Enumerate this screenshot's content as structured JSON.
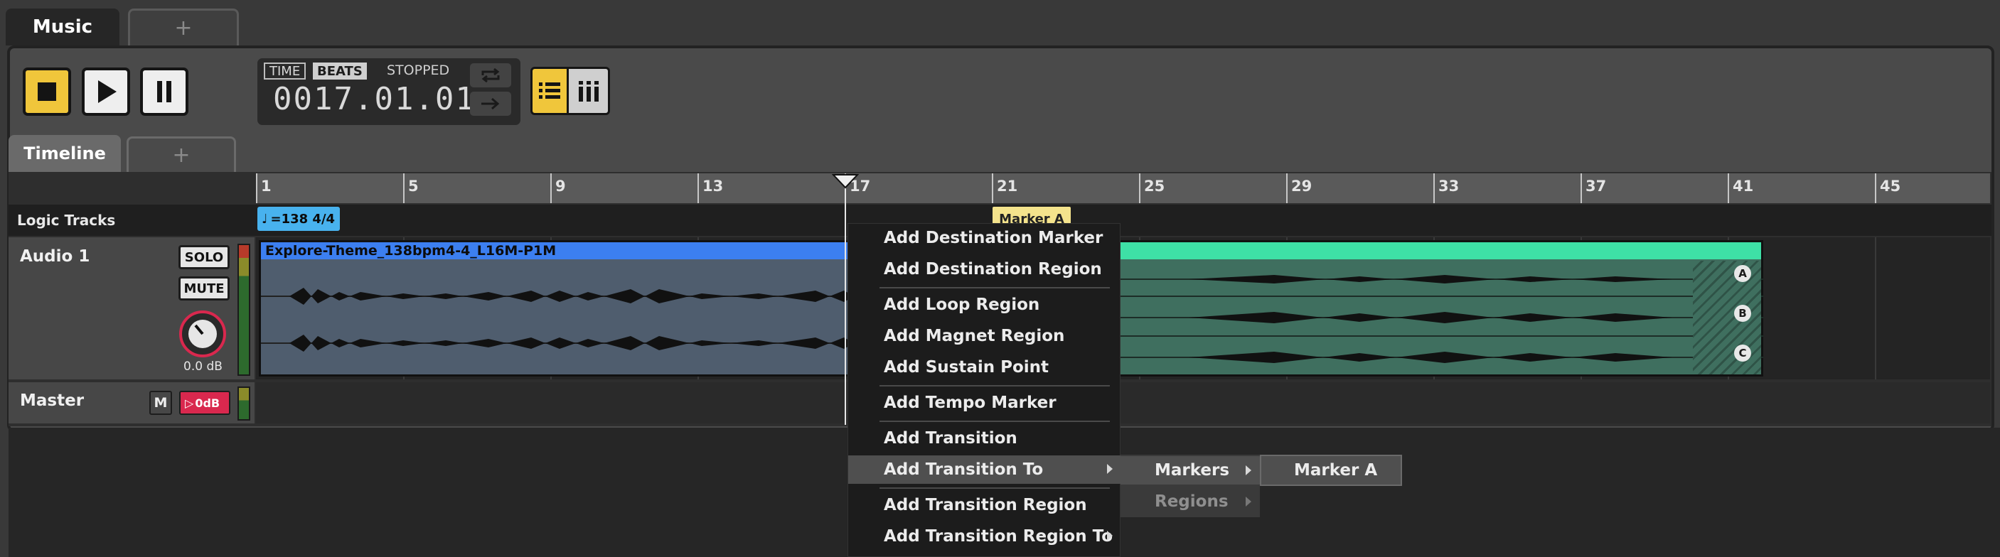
{
  "top_tabs": {
    "music": "Music",
    "add": "+"
  },
  "transport": {
    "mode_time": "TIME",
    "mode_beats": "BEATS",
    "status": "STOPPED",
    "time_value": "0017.01.01",
    "icons": [
      "stop-icon",
      "play-icon",
      "pause-icon",
      "loop-icon",
      "arrow-right-icon",
      "list-view-icon",
      "grid-view-icon"
    ],
    "accent_color": "#f0c63b"
  },
  "timeline_tabs": {
    "timeline": "Timeline",
    "add": "+"
  },
  "ruler": {
    "bars": [
      "1",
      "5",
      "9",
      "13",
      "17",
      "21",
      "25",
      "29",
      "33",
      "37",
      "41",
      "45"
    ]
  },
  "logic_tracks": {
    "label": "Logic Tracks",
    "tempo": "=138 4/4",
    "marker": "Marker A"
  },
  "audio_track": {
    "name": "Audio 1",
    "solo": "SOLO",
    "mute": "MUTE",
    "gain": "0.0 dB",
    "clip_name": "Explore-Theme_138bpm4-4_L16M-P1M",
    "lane_badges": [
      "A",
      "B",
      "C"
    ],
    "clip_colors": {
      "clip1": "#3c7ff0",
      "clip2": "#3ee0a6"
    }
  },
  "master_track": {
    "name": "Master",
    "m": "M",
    "volume": "0dB",
    "volume_color": "#d9284e"
  },
  "context_menu": {
    "items": [
      "Add Destination Marker",
      "Add Destination Region",
      "Add Loop Region",
      "Add Magnet Region",
      "Add Sustain Point",
      "Add Tempo Marker",
      "Add Transition",
      "Add Transition To",
      "Add Transition Region",
      "Add Transition Region To"
    ],
    "submenu": {
      "markers": "Markers",
      "regions": "Regions"
    },
    "submenu2": {
      "marker_a": "Marker A"
    }
  }
}
